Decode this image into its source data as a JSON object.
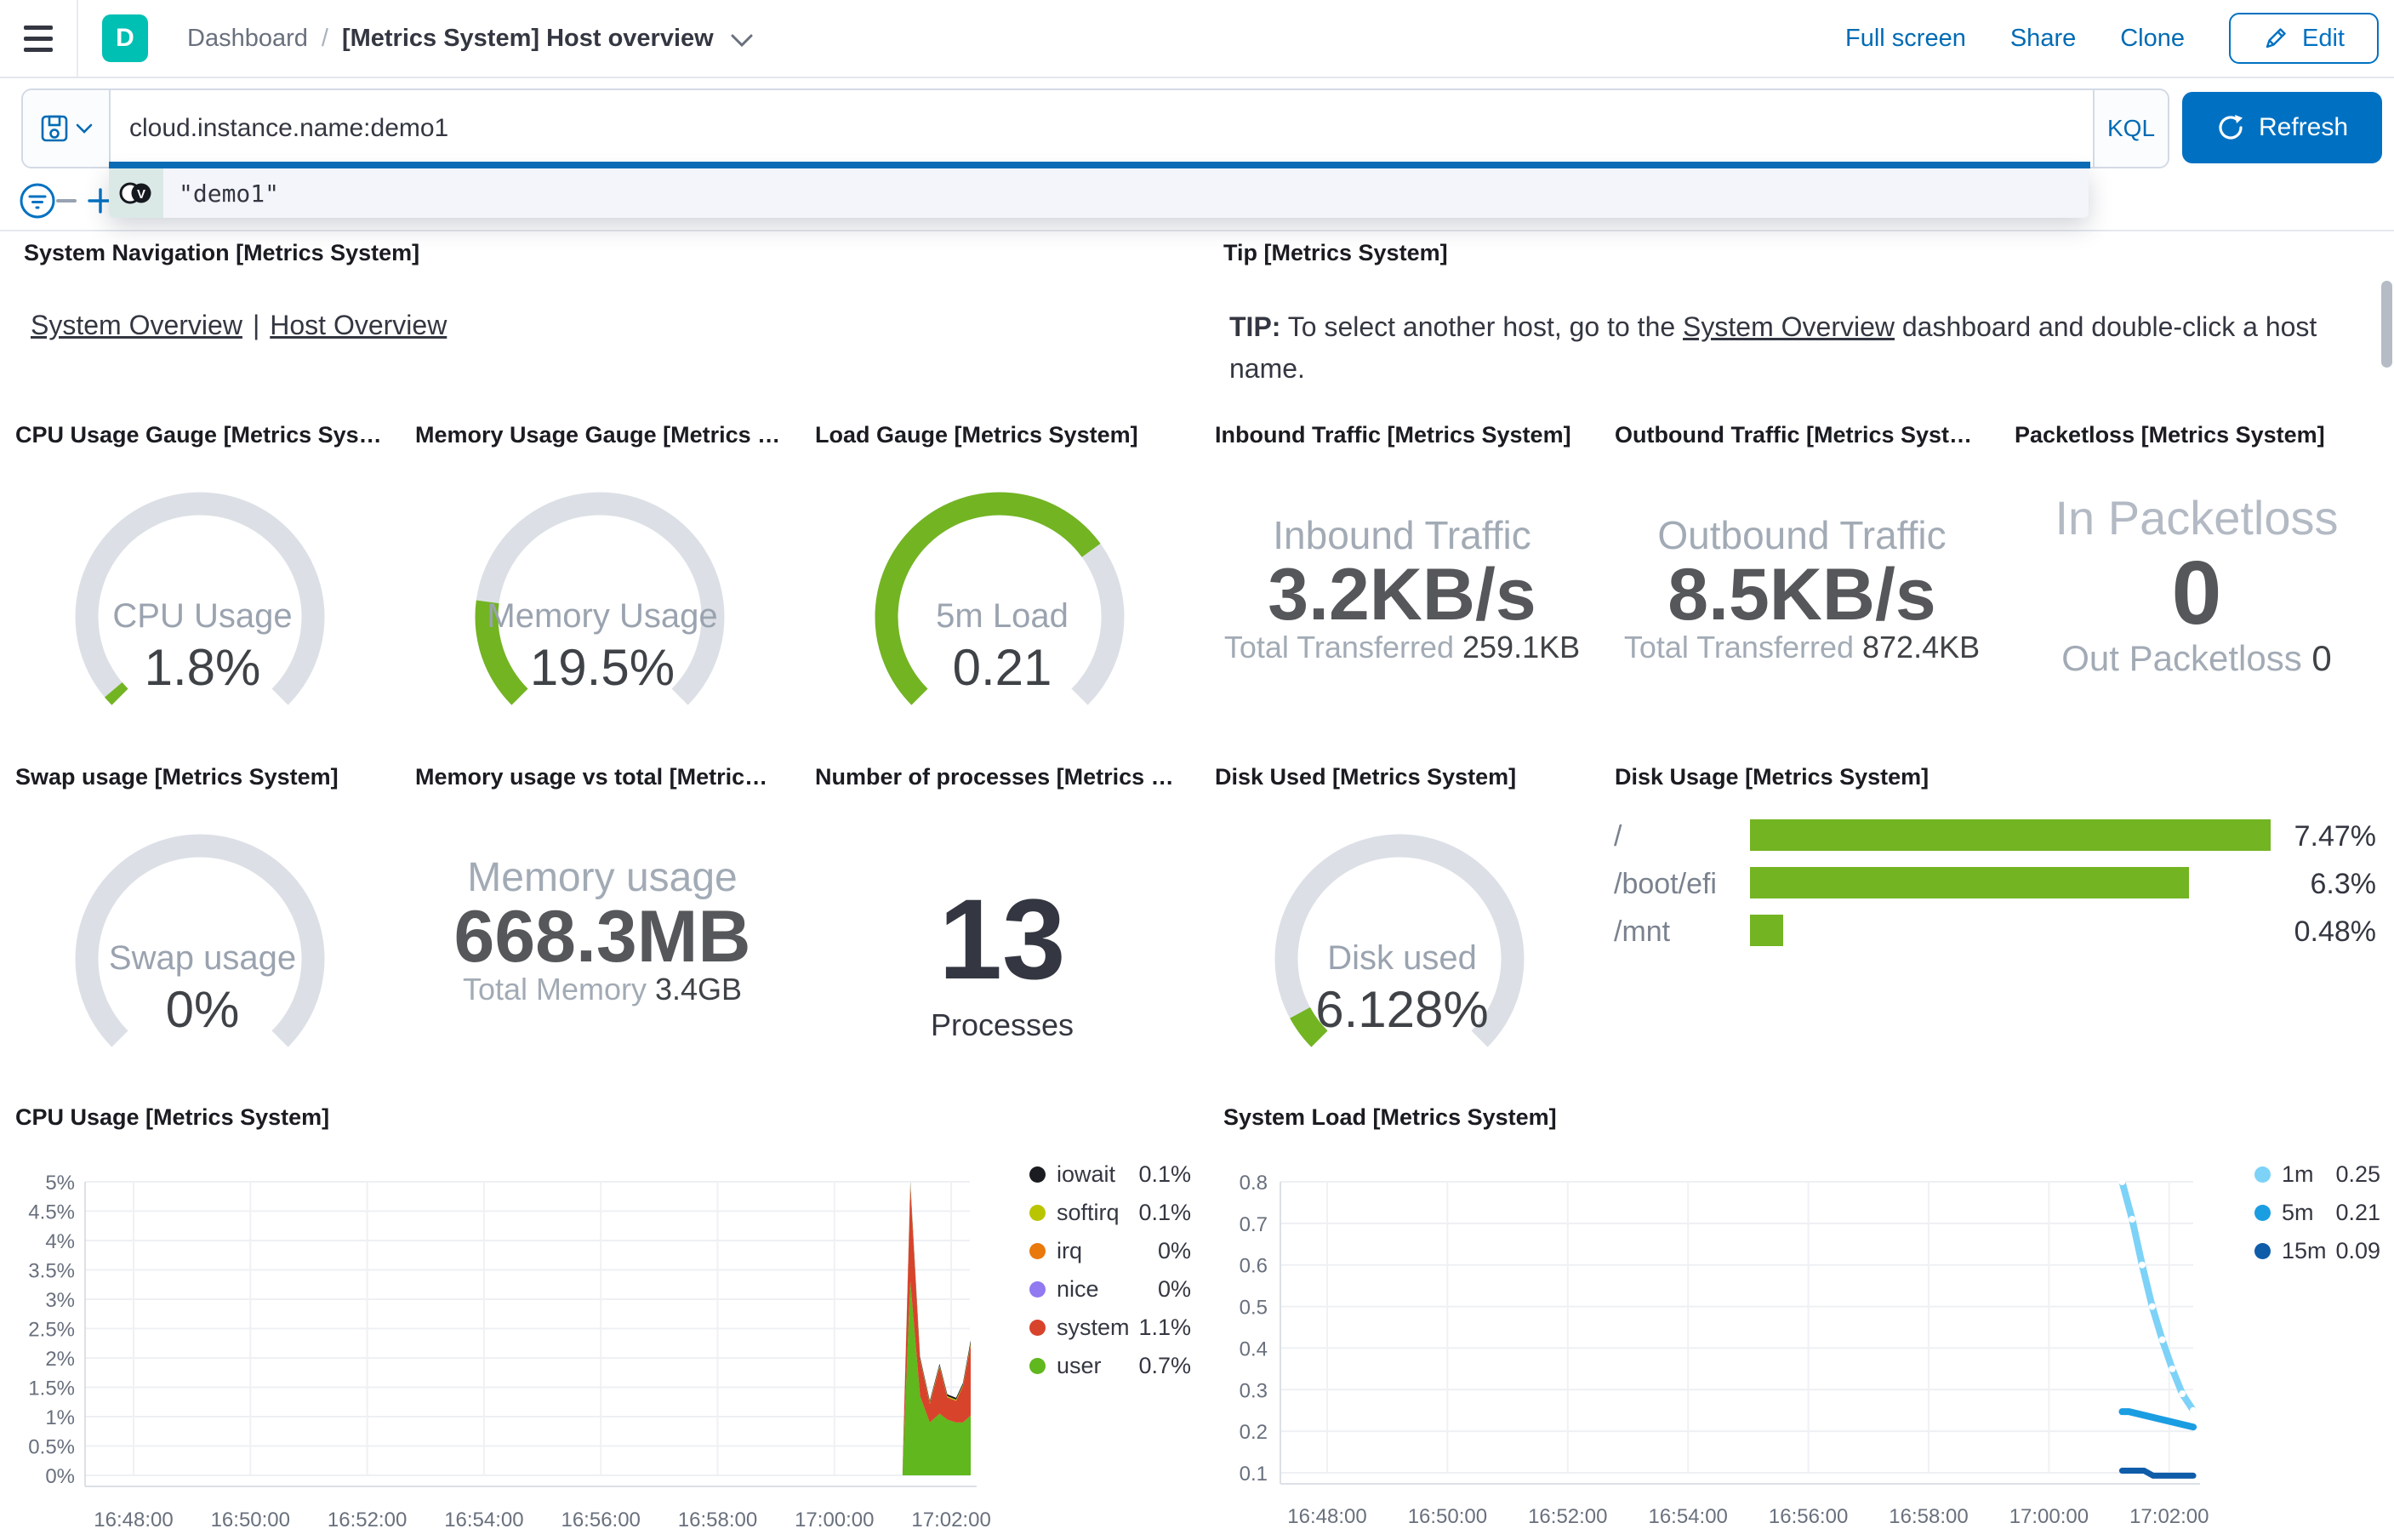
{
  "header": {
    "space_initial": "D",
    "breadcrumb": {
      "root": "Dashboard",
      "separator": "/",
      "current": "[Metrics System] Host overview"
    },
    "actions": {
      "full_screen": "Full screen",
      "share": "Share",
      "clone": "Clone",
      "edit": "Edit"
    }
  },
  "query_bar": {
    "query": "cloud.instance.name:demo1",
    "language": "KQL",
    "refresh": "Refresh",
    "suggestion": "\"demo1\"",
    "suggestion_token_letter": "V"
  },
  "colors": {
    "accent_teal": "#00BFB3",
    "link_blue": "#006BB4",
    "primary_blue": "#0071C2",
    "gauge_green": "#73B422",
    "gauge_track": "#DCE0E6"
  },
  "panels": {
    "system_navigation": {
      "title": "System Navigation [Metrics System]",
      "link1": "System Overview",
      "divider": "|",
      "link2": "Host Overview"
    },
    "tip": {
      "title": "Tip [Metrics System]",
      "bold": "TIP:",
      "text_before": " To select another host, go to the ",
      "link": "System Overview",
      "text_after": " dashboard and double-click a host name."
    },
    "cpu_gauge": {
      "title": "CPU Usage Gauge [Metrics Sys…",
      "label": "CPU Usage",
      "display": "1.8%",
      "value": 1.8,
      "max": 100
    },
    "memory_gauge": {
      "title": "Memory Usage Gauge [Metrics …",
      "label": "Memory Usage",
      "display": "19.5%",
      "value": 19.5,
      "max": 100
    },
    "load_gauge": {
      "title": "Load Gauge [Metrics System]",
      "label": "5m Load",
      "display": "0.21",
      "value": 0.21,
      "max": 0.3
    },
    "inbound": {
      "title": "Inbound Traffic [Metrics System]",
      "label": "Inbound Traffic",
      "value": "3.2KB/s",
      "sub_label": "Total Transferred ",
      "sub_value": "259.1KB"
    },
    "outbound": {
      "title": "Outbound Traffic [Metrics Syst…",
      "label": "Outbound Traffic",
      "value": "8.5KB/s",
      "sub_label": "Total Transferred ",
      "sub_value": "872.4KB"
    },
    "packetloss": {
      "title": "Packetloss [Metrics System]",
      "label": "In Packetloss",
      "value": "0",
      "sub_label": "Out Packetloss ",
      "sub_value": "0"
    },
    "swap_gauge": {
      "title": "Swap usage [Metrics System]",
      "label": "Swap usage",
      "display": "0%",
      "value": 0,
      "max": 100
    },
    "memory_vs_total": {
      "title": "Memory usage vs total [Metric…",
      "label": "Memory usage",
      "value": "668.3MB",
      "sub_label": "Total Memory ",
      "sub_value": "3.4GB"
    },
    "processes": {
      "title": "Number of processes [Metrics …",
      "value": "13",
      "label": "Processes"
    },
    "disk_used_gauge": {
      "title": "Disk Used [Metrics System]",
      "label": "Disk used",
      "display": "6.128%",
      "value": 6.128,
      "max": 100
    },
    "disk_usage": {
      "title": "Disk Usage [Metrics System]",
      "chart_data": {
        "type": "bar",
        "orientation": "horizontal",
        "categories": [
          "/",
          "/boot/efi",
          "/mnt"
        ],
        "values": [
          7.47,
          6.3,
          0.48
        ],
        "value_labels": [
          "7.47%",
          "6.3%",
          "0.48%"
        ],
        "xmax": 8,
        "bar_color": "#73B422"
      }
    },
    "cpu_chart": {
      "title": "CPU Usage [Metrics System]",
      "chart_data": {
        "type": "area",
        "stacked": true,
        "x_ticks": [
          "16:48:00",
          "16:50:00",
          "16:52:00",
          "16:54:00",
          "16:56:00",
          "16:58:00",
          "17:00:00",
          "17:02:00"
        ],
        "y_ticks": [
          "0%",
          "0.5%",
          "1%",
          "1.5%",
          "2%",
          "2.5%",
          "3%",
          "3.5%",
          "4%",
          "4.5%",
          "5%"
        ],
        "y_tick_vals": [
          0,
          0.5,
          1,
          1.5,
          2,
          2.5,
          3,
          3.5,
          4,
          4.5,
          5
        ],
        "ylim": [
          0,
          5
        ],
        "x": [
          790,
          798,
          808,
          818,
          828,
          836,
          845,
          852,
          860
        ],
        "series": [
          {
            "name": "user",
            "color": "#61B71E",
            "y": [
              0.05,
              3.3,
              1.35,
              0.9,
              1.05,
              0.95,
              0.9,
              0.9,
              1.02
            ]
          },
          {
            "name": "system",
            "color": "#D8432C",
            "y": [
              0.03,
              1.62,
              0.62,
              0.32,
              0.8,
              0.38,
              0.37,
              0.62,
              1.2
            ]
          },
          {
            "name": "softirq",
            "color": "#B9C500",
            "y": [
              0.01,
              0.04,
              0.02,
              0.02,
              0.02,
              0.02,
              0.02,
              0.02,
              0.03
            ]
          },
          {
            "name": "iowait",
            "color": "#1A1C21",
            "y": [
              0.01,
              0.04,
              0.03,
              0.03,
              0.03,
              0.03,
              0.03,
              0.03,
              0.05
            ]
          }
        ],
        "legend": [
          {
            "name": "iowait",
            "value": "0.1%",
            "color": "#1A1C21"
          },
          {
            "name": "softirq",
            "value": "0.1%",
            "color": "#B9C500"
          },
          {
            "name": "irq",
            "value": "0%",
            "color": "#E8790A"
          },
          {
            "name": "nice",
            "value": "0%",
            "color": "#9179F2"
          },
          {
            "name": "system",
            "value": "1.1%",
            "color": "#D8432C"
          },
          {
            "name": "user",
            "value": "0.7%",
            "color": "#61B71E"
          }
        ]
      }
    },
    "load_chart": {
      "title": "System Load [Metrics System]",
      "chart_data": {
        "type": "line",
        "x_ticks": [
          "16:48:00",
          "16:50:00",
          "16:52:00",
          "16:54:00",
          "16:56:00",
          "16:58:00",
          "17:00:00",
          "17:02:00"
        ],
        "y_ticks": [
          "0.1",
          "0.2",
          "0.3",
          "0.4",
          "0.5",
          "0.6",
          "0.7",
          "0.8"
        ],
        "y_tick_vals": [
          0.1,
          0.2,
          0.3,
          0.4,
          0.5,
          0.6,
          0.7,
          0.8
        ],
        "ylim": [
          0.1,
          0.8
        ],
        "series": [
          {
            "name": "1m",
            "color": "#7DD2F7",
            "width": 8,
            "markers": true,
            "x": [
              793,
              803,
              813,
              823,
              833,
              843,
              853,
              864
            ],
            "y": [
              0.8,
              0.71,
              0.6,
              0.5,
              0.42,
              0.35,
              0.29,
              0.25
            ]
          },
          {
            "name": "5m",
            "color": "#1B9DE2",
            "width": 8,
            "x": [
              793,
              800,
              864
            ],
            "y": [
              0.247,
              0.247,
              0.21
            ]
          },
          {
            "name": "15m",
            "color": "#0F5CA9",
            "width": 7,
            "x": [
              793,
              815,
              824,
              864
            ],
            "y": [
              0.105,
              0.105,
              0.093,
              0.093
            ]
          }
        ],
        "legend": [
          {
            "name": "1m",
            "value": "0.25",
            "color": "#7DD2F7"
          },
          {
            "name": "5m",
            "value": "0.21",
            "color": "#1B9DE2"
          },
          {
            "name": "15m",
            "value": "0.09",
            "color": "#0F5CA9"
          }
        ]
      }
    }
  }
}
